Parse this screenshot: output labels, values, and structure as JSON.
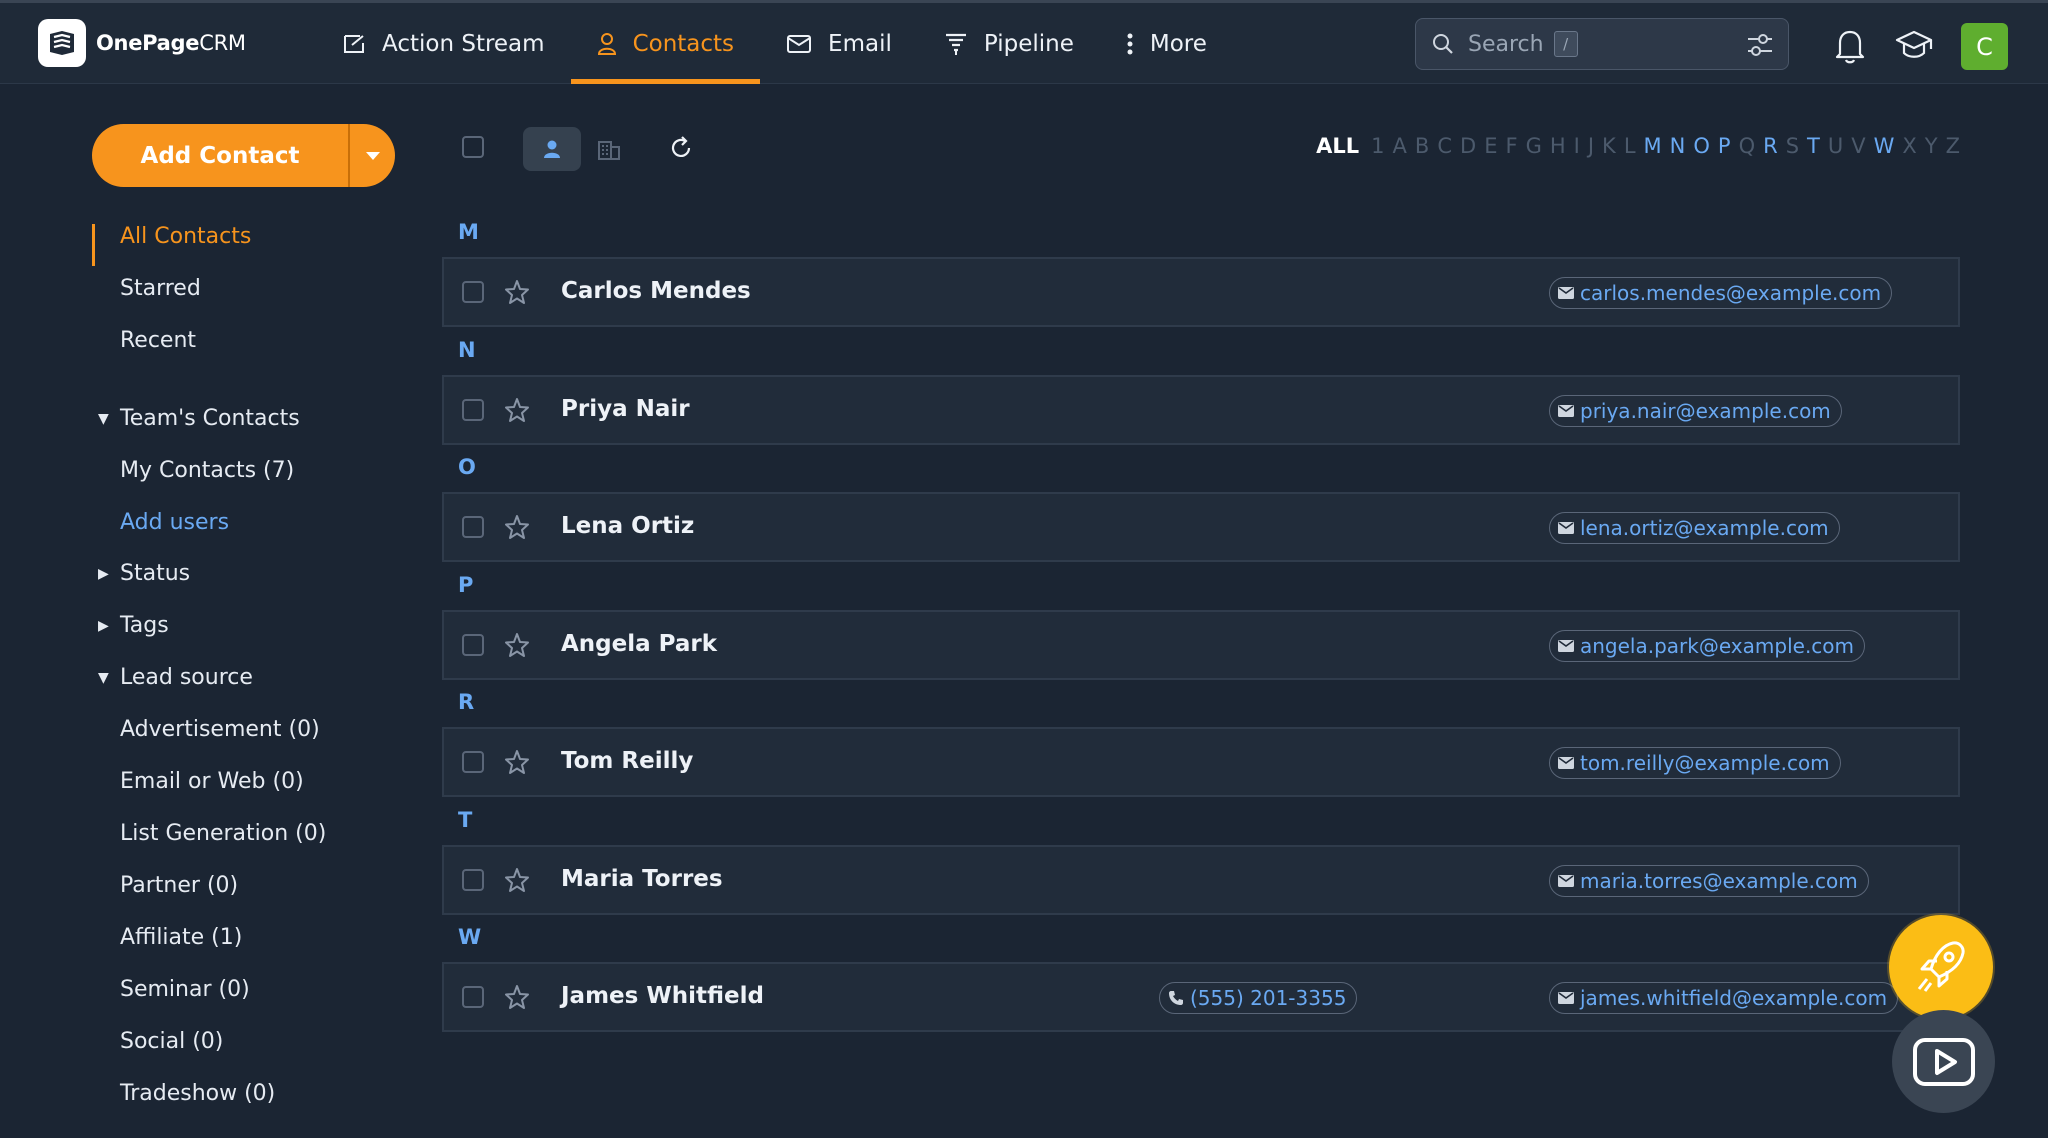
{
  "app": {
    "logo_brand": "OnePage",
    "logo_suffix": "CRM"
  },
  "nav": [
    {
      "label": "Action Stream",
      "icon": "action-stream-icon"
    },
    {
      "label": "Contacts",
      "icon": "person-icon",
      "active": true
    },
    {
      "label": "Email",
      "icon": "envelope-icon"
    },
    {
      "label": "Pipeline",
      "icon": "funnel-icon"
    },
    {
      "label": "More",
      "icon": "kebab-icon"
    }
  ],
  "search": {
    "placeholder": "Search",
    "shortcut": "/"
  },
  "user": {
    "avatar_letter": "C"
  },
  "colors": {
    "accent": "#f7941d",
    "link": "#6aa9f2",
    "background": "#1b2533",
    "avatar": "#5fae2f",
    "rocket": "#fbbd15"
  },
  "actions": {
    "add_contact": "Add Contact"
  },
  "sidebar": {
    "views": [
      {
        "label": "All Contacts",
        "active": true
      },
      {
        "label": "Starred"
      },
      {
        "label": "Recent"
      }
    ],
    "team_contacts": {
      "label": "Team's Contacts",
      "items": [
        {
          "label": "My Contacts (7)"
        },
        {
          "label": "Add users"
        }
      ]
    },
    "status": {
      "label": "Status"
    },
    "tags": {
      "label": "Tags"
    },
    "lead_source": {
      "label": "Lead source",
      "items": [
        {
          "label": "Advertisement (0)"
        },
        {
          "label": "Email or Web (0)"
        },
        {
          "label": "List Generation (0)"
        },
        {
          "label": "Partner (0)"
        },
        {
          "label": "Affiliate (1)"
        },
        {
          "label": "Seminar (0)"
        },
        {
          "label": "Social (0)"
        },
        {
          "label": "Tradeshow (0)"
        }
      ]
    }
  },
  "alphabet": {
    "all": "ALL",
    "letters": [
      "1",
      "A",
      "B",
      "C",
      "D",
      "E",
      "F",
      "G",
      "H",
      "I",
      "J",
      "K",
      "L",
      "M",
      "N",
      "O",
      "P",
      "Q",
      "R",
      "S",
      "T",
      "U",
      "V",
      "W",
      "X",
      "Y",
      "Z"
    ],
    "active": [
      "M",
      "N",
      "O",
      "P",
      "R",
      "T",
      "W"
    ]
  },
  "contacts": [
    {
      "letter": "M",
      "name": "Carlos Mendes",
      "email": "carlos.mendes@example.com"
    },
    {
      "letter": "N",
      "name": "Priya Nair",
      "email": "priya.nair@example.com"
    },
    {
      "letter": "O",
      "name": "Lena Ortiz",
      "email": "lena.ortiz@example.com"
    },
    {
      "letter": "P",
      "name": "Angela Park",
      "email": "angela.park@example.com"
    },
    {
      "letter": "R",
      "name": "Tom Reilly",
      "email": "tom.reilly@example.com"
    },
    {
      "letter": "T",
      "name": "Maria Torres",
      "email": "maria.torres@example.com"
    },
    {
      "letter": "W",
      "name": "James Whitfield",
      "phone": "(555) 201-3355",
      "email": "james.whitfield@example.com"
    }
  ]
}
